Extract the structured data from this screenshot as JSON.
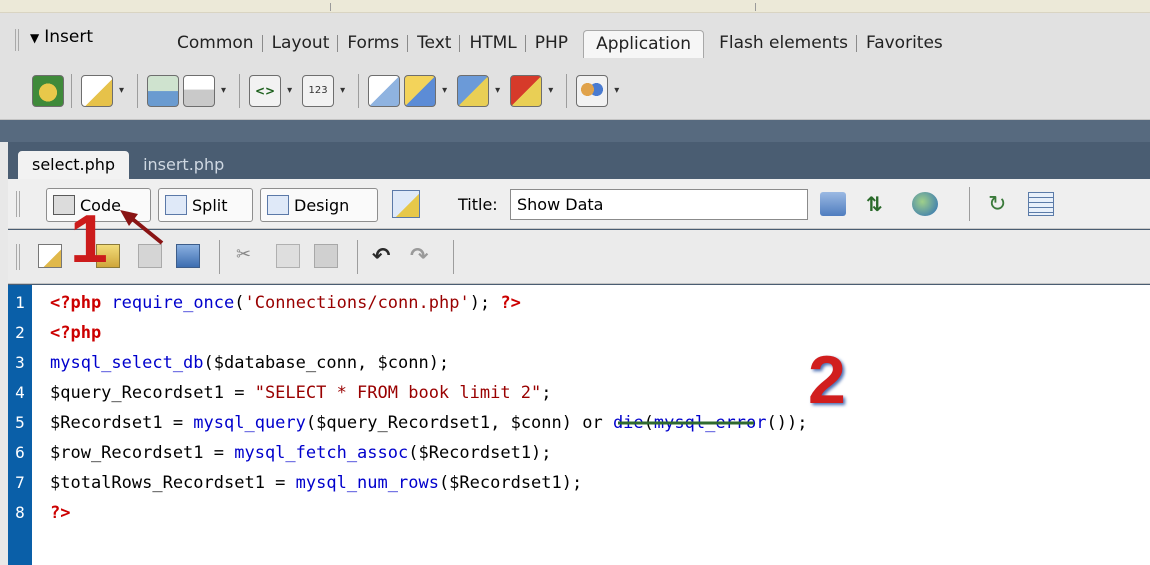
{
  "insert_panel": {
    "label": "Insert",
    "tabs": [
      "Common",
      "Layout",
      "Forms",
      "Text",
      "HTML",
      "PHP",
      "Application",
      "Flash elements",
      "Favorites"
    ],
    "active_tab": "Application",
    "icons": [
      {
        "name": "recordset-icon",
        "dropdown": false
      },
      {
        "name": "dynamic-data-icon",
        "dropdown": true
      },
      {
        "name": "repeated-region-icon",
        "dropdown": false
      },
      {
        "name": "show-region-icon",
        "dropdown": true
      },
      {
        "name": "recordset-paging-icon",
        "dropdown": true
      },
      {
        "name": "display-record-count-icon",
        "dropdown": true
      },
      {
        "name": "master-detail-icon",
        "dropdown": false
      },
      {
        "name": "insert-record-icon",
        "dropdown": true
      },
      {
        "name": "update-record-icon",
        "dropdown": true
      },
      {
        "name": "delete-record-icon",
        "dropdown": true
      },
      {
        "name": "user-authentication-icon",
        "dropdown": true
      }
    ]
  },
  "document": {
    "file_tabs": [
      "select.php",
      "insert.php"
    ],
    "active_file": "select.php",
    "view_buttons": {
      "code": "Code",
      "split": "Split",
      "design": "Design"
    },
    "title_label": "Title:",
    "title_value": "Show Data"
  },
  "code_lines": [
    {
      "num": "1",
      "parts": [
        [
          "tag",
          "<?php"
        ],
        [
          "plain",
          " "
        ],
        [
          "fn",
          "require_once"
        ],
        [
          "plain",
          "("
        ],
        [
          "str",
          "'Connections/conn.php'"
        ],
        [
          "plain",
          "); "
        ],
        [
          "tag",
          "?>"
        ]
      ]
    },
    {
      "num": "2",
      "parts": [
        [
          "tag",
          "<?php"
        ]
      ]
    },
    {
      "num": "3",
      "parts": [
        [
          "fn",
          "mysql_select_db"
        ],
        [
          "plain",
          "($database_conn, $conn);"
        ]
      ]
    },
    {
      "num": "4",
      "parts": [
        [
          "plain",
          "$query_Recordset1 = "
        ],
        [
          "str",
          "\"SELECT * FROM book limit 2\""
        ],
        [
          "plain",
          ";"
        ]
      ]
    },
    {
      "num": "5",
      "parts": [
        [
          "plain",
          "$Recordset1 = "
        ],
        [
          "fn",
          "mysql_query"
        ],
        [
          "plain",
          "($query_Recordset1, $conn) or "
        ],
        [
          "fn",
          "die"
        ],
        [
          "plain",
          "("
        ],
        [
          "fn",
          "mysql_error"
        ],
        [
          "plain",
          "());"
        ]
      ]
    },
    {
      "num": "6",
      "parts": [
        [
          "plain",
          "$row_Recordset1 = "
        ],
        [
          "fn",
          "mysql_fetch_assoc"
        ],
        [
          "plain",
          "($Recordset1);"
        ]
      ]
    },
    {
      "num": "7",
      "parts": [
        [
          "plain",
          "$totalRows_Recordset1 = "
        ],
        [
          "fn",
          "mysql_num_rows"
        ],
        [
          "plain",
          "($Recordset1);"
        ]
      ]
    },
    {
      "num": "8",
      "parts": [
        [
          "tag",
          "?>"
        ]
      ]
    }
  ],
  "annotations": {
    "step1": "1",
    "step2": "2"
  },
  "colors": {
    "accent_red": "#cc1b1b",
    "gutter_blue": "#0a5fa8",
    "panel_dark": "#4a5d72"
  }
}
